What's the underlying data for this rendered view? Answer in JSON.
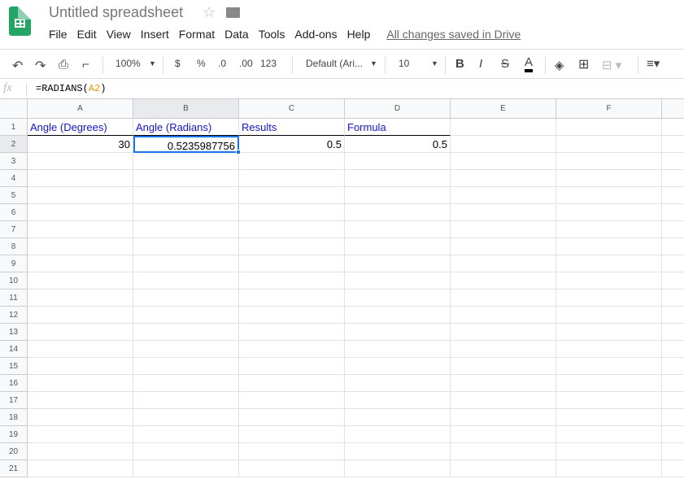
{
  "app": {
    "title": "Untitled spreadsheet",
    "saved_status": "All changes saved in Drive"
  },
  "menu": [
    "File",
    "Edit",
    "View",
    "Insert",
    "Format",
    "Data",
    "Tools",
    "Add-ons",
    "Help"
  ],
  "toolbar": {
    "zoom": "100%",
    "currency": "$",
    "percent": "%",
    "dec_decrease": ".0",
    "dec_increase": ".00",
    "more_formats": "123",
    "font": "Default (Ari...",
    "font_size": "10",
    "bold": "B",
    "italic": "I",
    "strike": "S",
    "text_color_label": "A",
    "text_color": "#000000"
  },
  "formula_bar": {
    "fx": "fx",
    "prefix": "=RADIANS(",
    "ref": "A2",
    "suffix": ")"
  },
  "columns": [
    "A",
    "B",
    "C",
    "D",
    "E",
    "F"
  ],
  "rows": [
    "1",
    "2",
    "3",
    "4",
    "5",
    "6",
    "7",
    "8",
    "9",
    "10",
    "11",
    "12",
    "13",
    "14",
    "15",
    "16",
    "17",
    "18",
    "19",
    "20",
    "21"
  ],
  "cells": {
    "A1": "Angle (Degrees)",
    "B1": "Angle (Radians)",
    "C1": "Results",
    "D1": "Formula",
    "A2": "30",
    "B2": "0.5235987756",
    "C2": "0.5",
    "D2": "0.5"
  },
  "selected_cell": "B2"
}
